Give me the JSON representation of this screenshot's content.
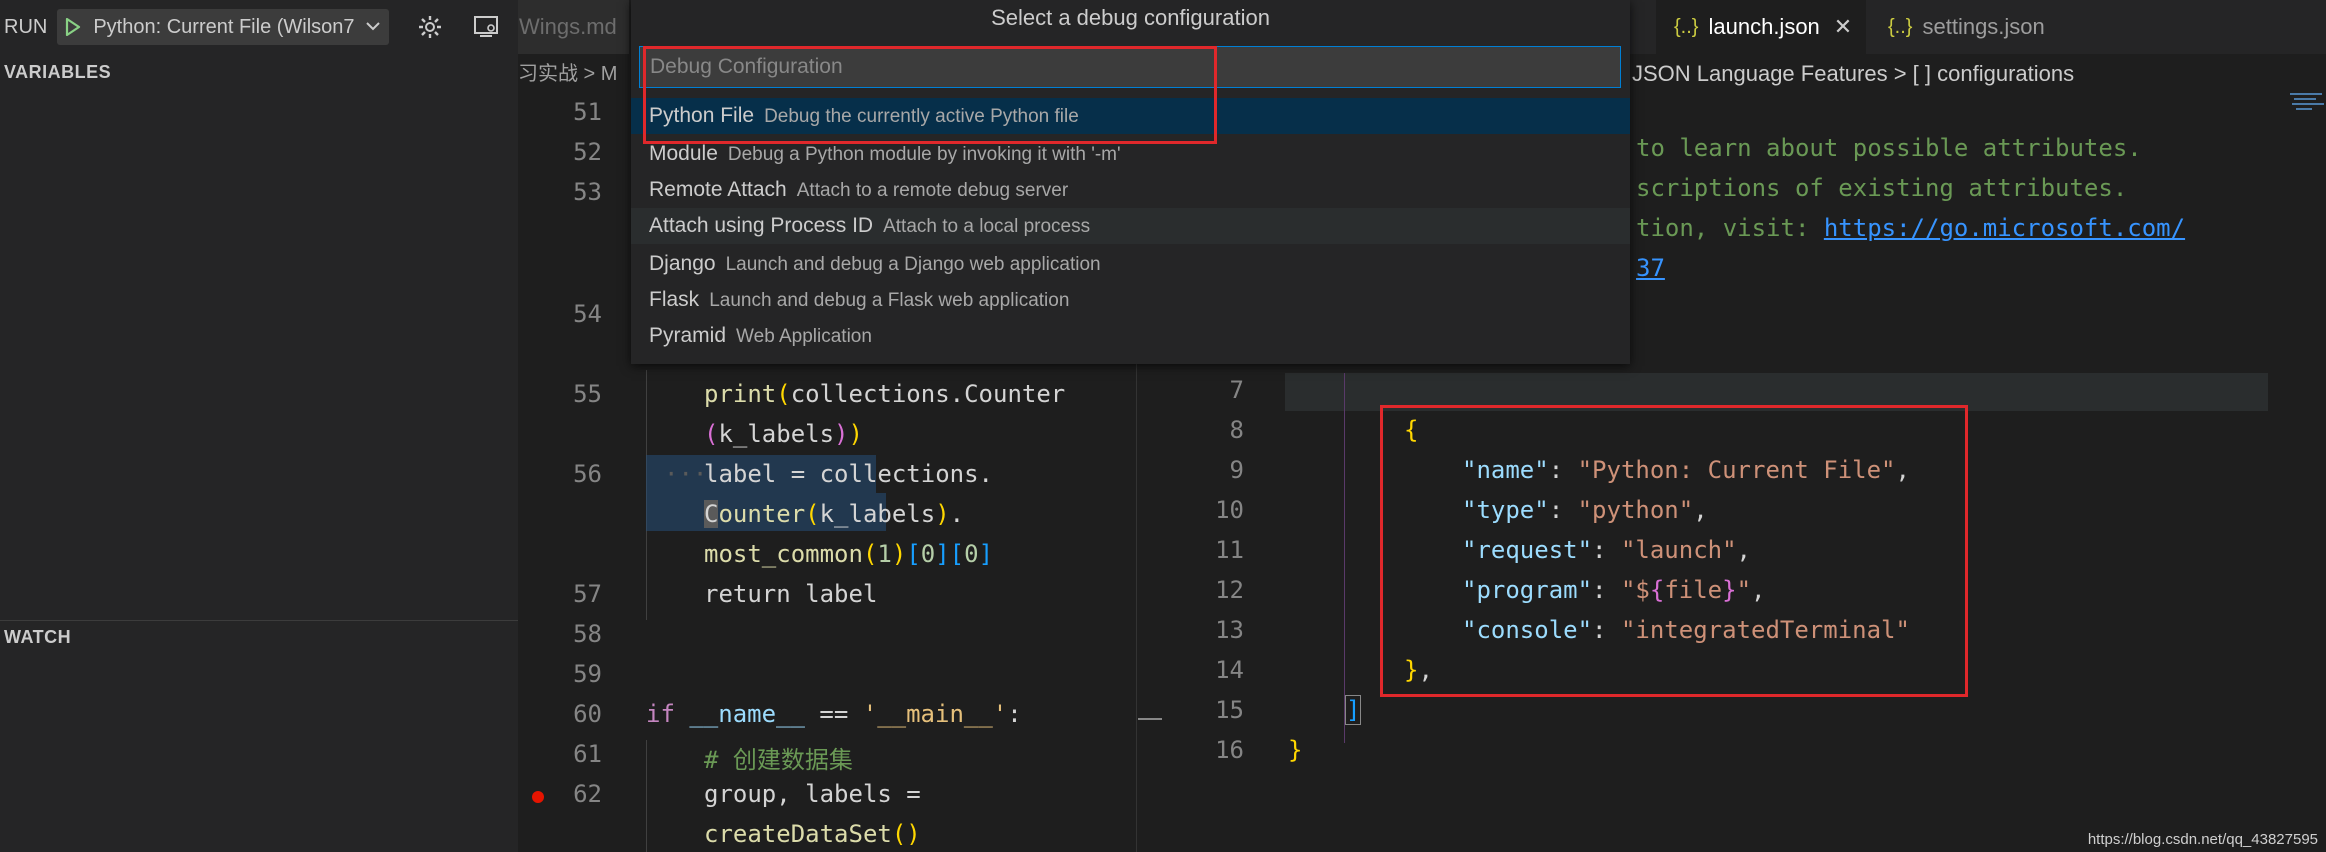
{
  "sidebar": {
    "run_label": "RUN",
    "config_name": "Python: Current File (Wilson7",
    "variables_header": "VARIABLES",
    "watch_header": "WATCH"
  },
  "left_editor": {
    "tab_label": "Wings.md",
    "breadcrumb": "习实战 > M",
    "lines": [
      "51",
      "52",
      "53",
      "54",
      "55",
      "56",
      "57",
      "58",
      "59",
      "60",
      "61",
      "62"
    ],
    "code": {
      "l55a_fn": "print",
      "l55a_rest": "collections.Counter",
      "l55b_inner": "k_labels",
      "l56a": "label = collections.",
      "l56b_c": "C",
      "l56b_fn": "ounter",
      "l56b_arg": "k_labels",
      "l56c_fn": "most_common",
      "l56c_num": "1",
      "l56c_idx0": "0",
      "l57": "return label",
      "l60_kw": "if",
      "l60_var": "__name__",
      "l60_op": " == ",
      "l60_str": "'__main__'",
      "l61": "# 创建数据集",
      "l62a": "group, labels =",
      "l62b_fn": "createDataSet"
    }
  },
  "right_editor": {
    "tabs": [
      {
        "label": "launch.json",
        "icon": "{..}"
      },
      {
        "label": "settings.json",
        "icon": "{..}"
      }
    ],
    "breadcrumb": "JSON Language Features > [ ] configurations",
    "comments": {
      "c1": "to learn about possible attributes.",
      "c2": "scriptions of existing attributes.",
      "c3_text": "tion, visit: ",
      "c3_link": "https://go.microsoft.com/",
      "c4_link": "37"
    },
    "lines": [
      "7",
      "8",
      "9",
      "10",
      "11",
      "12",
      "13",
      "14",
      "15",
      "16"
    ],
    "json": {
      "open_brace": "{",
      "name_key": "\"name\"",
      "name_val": "\"Python: Current File\"",
      "type_key": "\"type\"",
      "type_val": "\"python\"",
      "request_key": "\"request\"",
      "request_val": "\"launch\"",
      "program_key": "\"program\"",
      "program_val_a": "\"$",
      "program_val_b": "{",
      "program_val_c": "file",
      "program_val_d": "}",
      "program_val_e": "\"",
      "console_key": "\"console\"",
      "console_val": "\"integratedTerminal\"",
      "close_brace": "}",
      "close_bracket": "]",
      "final_brace": "}"
    }
  },
  "quick_pick": {
    "title": "Select a debug configuration",
    "placeholder": "Debug Configuration",
    "items": [
      {
        "label": "Python File",
        "desc": "Debug the currently active Python file"
      },
      {
        "label": "Module",
        "desc": "Debug a Python module by invoking it with '-m'"
      },
      {
        "label": "Remote Attach",
        "desc": "Attach to a remote debug server"
      },
      {
        "label": "Attach using Process ID",
        "desc": "Attach to a local process"
      },
      {
        "label": "Django",
        "desc": "Launch and debug a Django web application"
      },
      {
        "label": "Flask",
        "desc": "Launch and debug a Flask web application"
      },
      {
        "label": "Pyramid",
        "desc": "Web Application"
      }
    ]
  },
  "watermark": "https://blog.csdn.net/qq_43827595",
  "colors": {
    "accent": "#007fd4",
    "highlight_box": "#e0282b",
    "play": "#89d185"
  }
}
